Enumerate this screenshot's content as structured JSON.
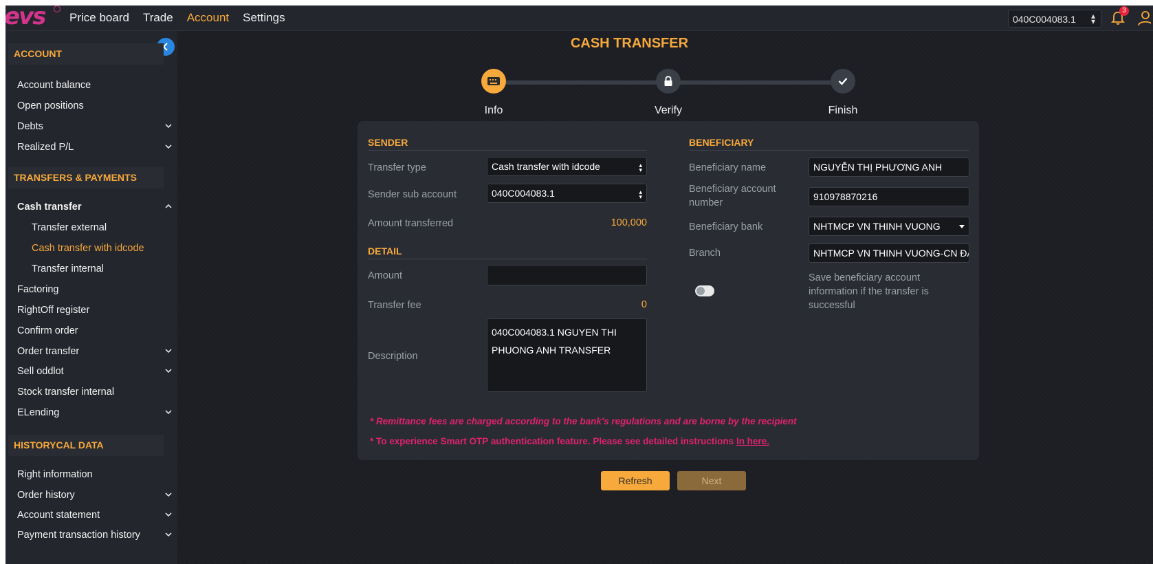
{
  "nav": {
    "items": [
      "Price board",
      "Trade",
      "Account",
      "Settings"
    ],
    "active": "Account"
  },
  "header": {
    "account_select": "040C004083.1",
    "notification_count": "3"
  },
  "sidebar": {
    "sections": [
      {
        "title": "ACCOUNT"
      },
      {
        "title": "TRANSFERS & PAYMENTS"
      },
      {
        "title": "HISTORYCAL DATA"
      }
    ],
    "account_items": [
      "Account balance",
      "Open positions",
      "Debts",
      "Realized P/L"
    ],
    "transfer_items": [
      "Cash transfer",
      "Transfer external",
      "Cash transfer with idcode",
      "Transfer internal",
      "Factoring",
      "RightOff register",
      "Confirm order",
      "Order transfer",
      "Sell oddlot",
      "Stock transfer internal",
      "ELending"
    ],
    "history_items": [
      "Right information",
      "Order history",
      "Account statement",
      "Payment transaction history"
    ]
  },
  "page": {
    "title": "CASH TRANSFER"
  },
  "steps": [
    "Info",
    "Verify",
    "Finish"
  ],
  "sender": {
    "heading": "SENDER",
    "transfer_type_label": "Transfer type",
    "transfer_type_value": "Cash transfer with idcode",
    "sub_account_label": "Sender sub account",
    "sub_account_value": "040C004083.1",
    "amount_transferred_label": "Amount transferred",
    "amount_transferred_value": "100,000"
  },
  "detail": {
    "heading": "DETAIL",
    "amount_label": "Amount",
    "amount_value": "",
    "fee_label": "Transfer fee",
    "fee_value": "0",
    "description_label": "Description",
    "description_value": "040C004083.1 NGUYEN THI PHUONG ANH TRANSFER"
  },
  "beneficiary": {
    "heading": "BENEFICIARY",
    "name_label": "Beneficiary name",
    "name_value": "NGUYỄN THỊ PHƯƠNG ANH",
    "account_label": "Beneficiary account number",
    "account_value": "910978870216",
    "bank_label": "Beneficiary bank",
    "bank_value": "NHTMCP VN THINH VUONG",
    "branch_label": "Branch",
    "branch_value": "NHTMCP VN THINH VUONG-CN ĐÀ NẴNG",
    "save_text": "Save beneficiary account information if the transfer is successful"
  },
  "notes": {
    "fee_note": "* Remittance fees are charged according to the bank's regulations and are borne by the recipient",
    "otp_note": "* To experience Smart OTP authentication feature. Please see detailed instructions",
    "otp_link": "In here."
  },
  "buttons": {
    "refresh": "Refresh",
    "next": "Next"
  },
  "colors": {
    "accent": "#f7a93b",
    "warning": "#e0226f",
    "brand": "#d3358c"
  }
}
